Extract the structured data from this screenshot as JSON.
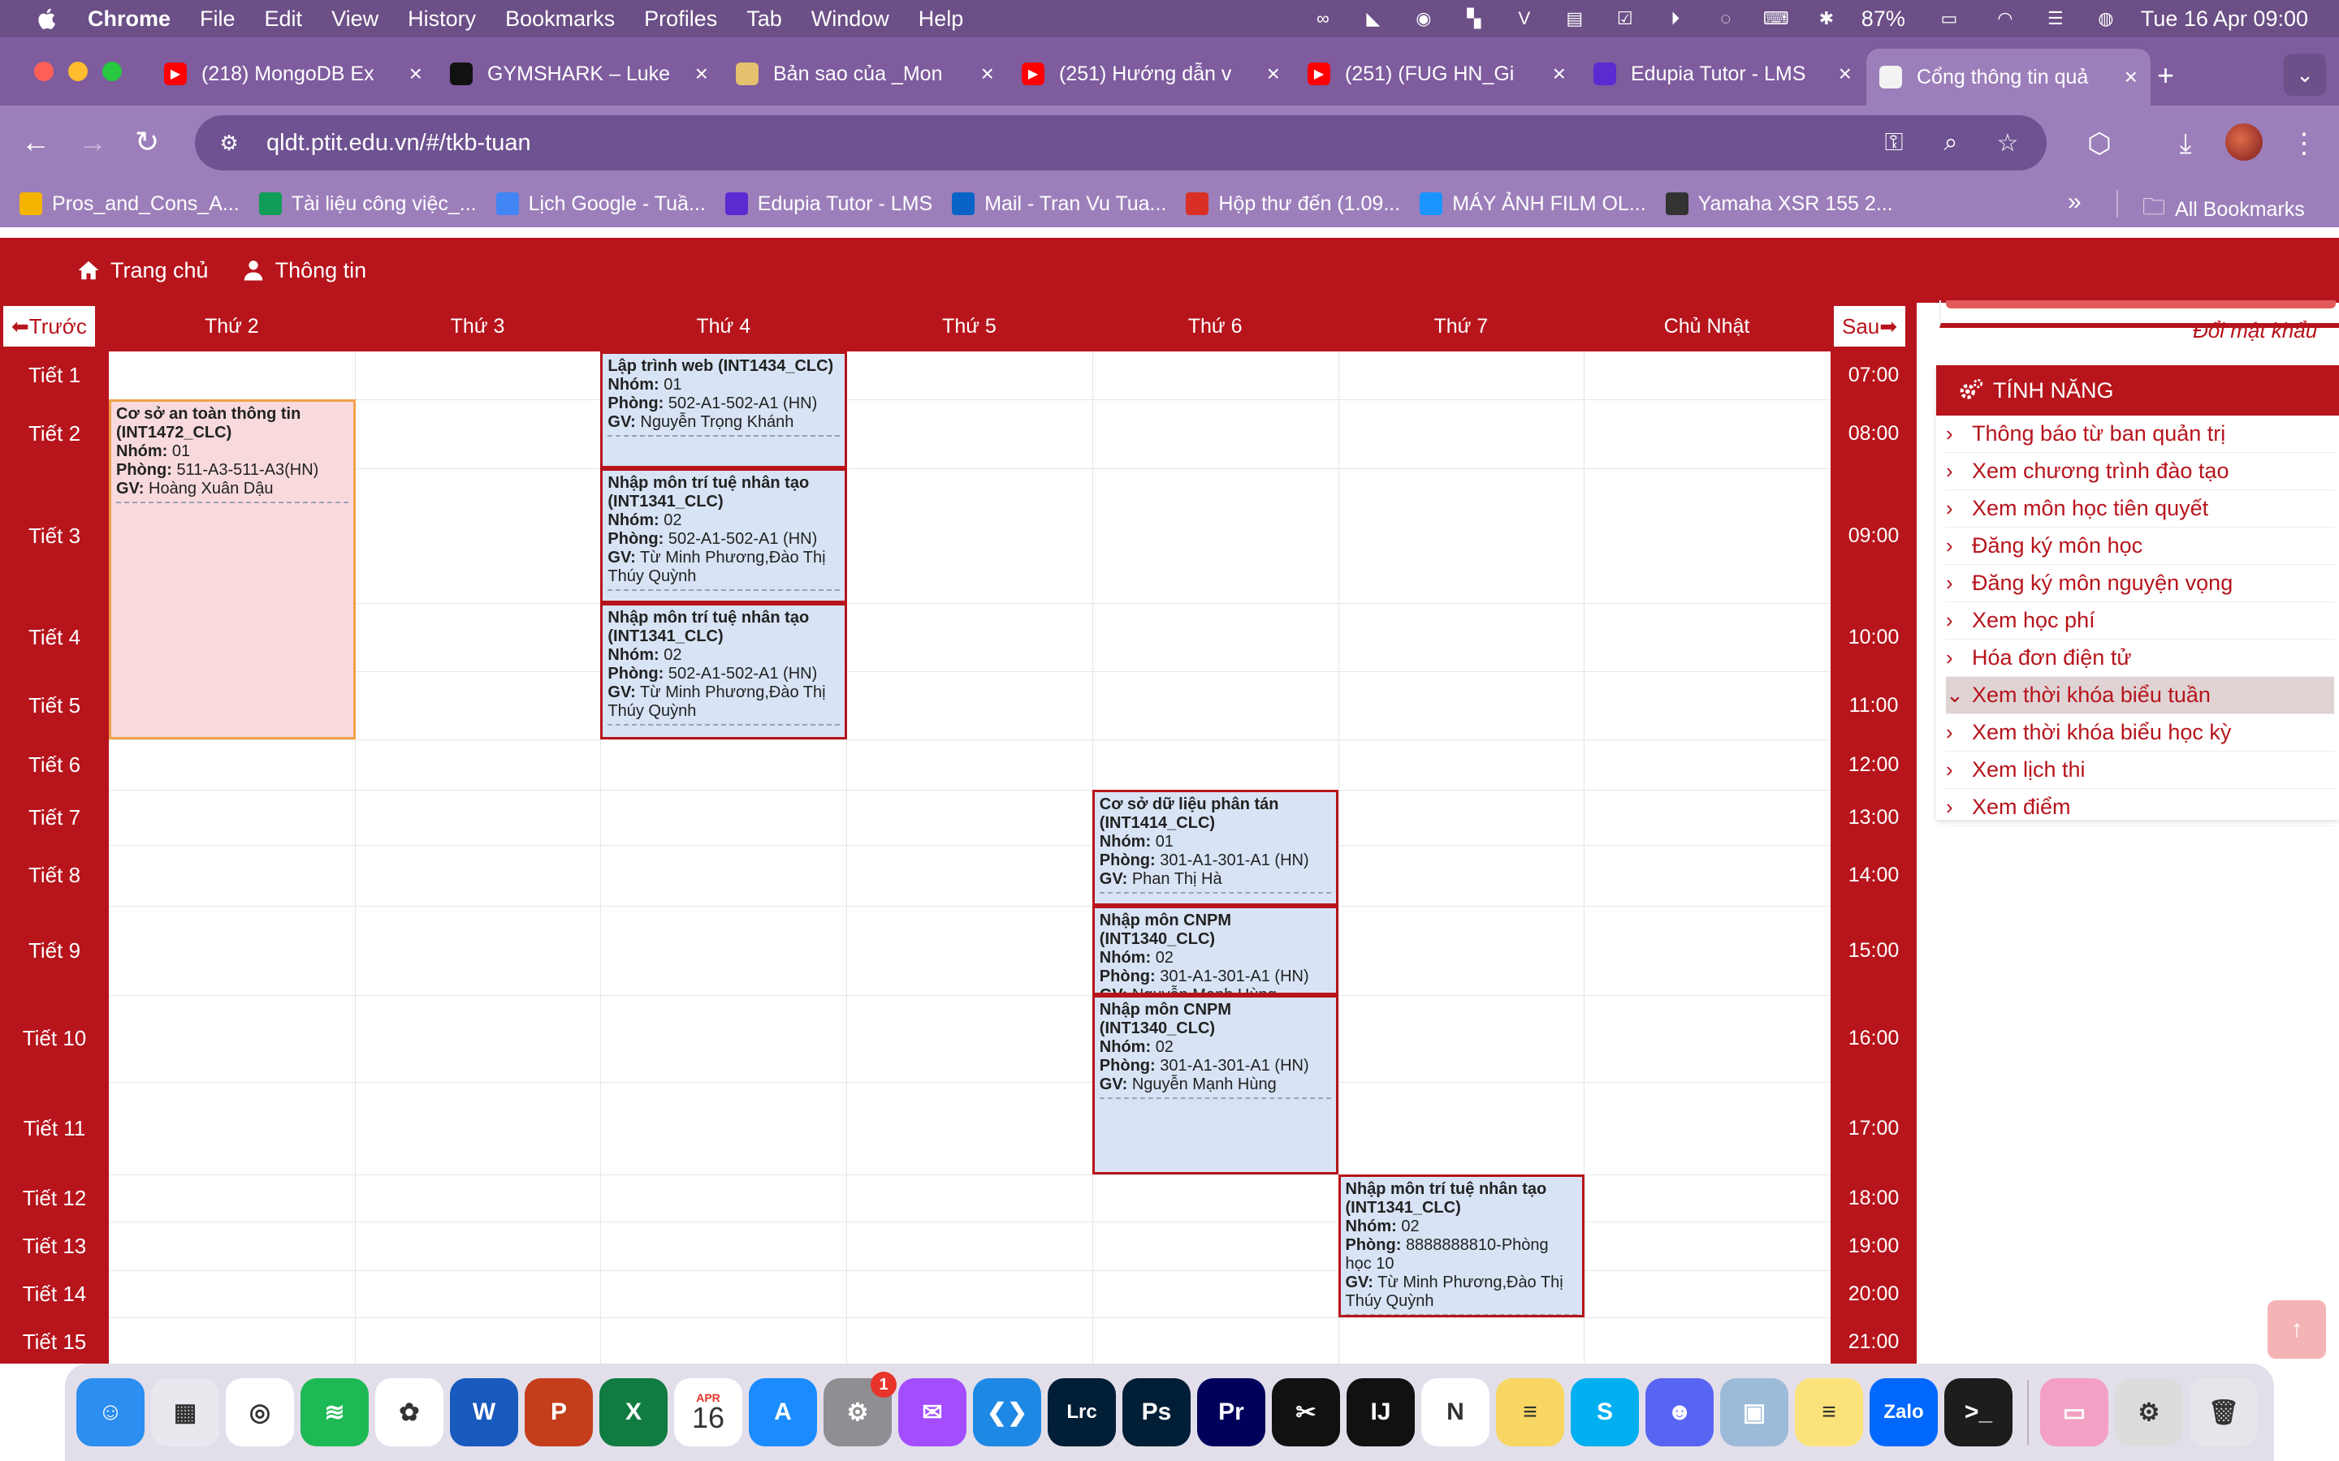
{
  "menubar": {
    "app": "Chrome",
    "items": [
      "File",
      "Edit",
      "View",
      "History",
      "Bookmarks",
      "Profiles",
      "Tab",
      "Window",
      "Help"
    ],
    "battery": "87%",
    "clock": "Tue 16 Apr  09:00"
  },
  "tabs": [
    {
      "title": "(218) MongoDB Ex",
      "icon": "youtube-icon",
      "color": "#ff0000"
    },
    {
      "title": "GYMSHARK – Luke",
      "icon": "gymshark-icon",
      "color": "#111111"
    },
    {
      "title": "Bản sao của _Mon",
      "icon": "doc-icon",
      "color": "#e3c16f"
    },
    {
      "title": "(251) Hướng dẫn v",
      "icon": "youtube-icon",
      "color": "#ff0000"
    },
    {
      "title": "(251) (FUG HN_Gi",
      "icon": "youtube-icon",
      "color": "#ff0000"
    },
    {
      "title": "Edupia Tutor - LMS",
      "icon": "edupia-icon",
      "color": "#5b2bd1"
    },
    {
      "title": "Cổng thông tin quả",
      "icon": "ptit-icon",
      "color": "#f3f3f3",
      "active": true
    }
  ],
  "address": {
    "url": "qldt.ptit.edu.vn/#/tkb-tuan"
  },
  "bookmarks": [
    {
      "label": "Pros_and_Cons_A...",
      "icon": "drive-icon",
      "color": "#f4b400"
    },
    {
      "label": "Tài liệu công việc_...",
      "icon": "sheets-icon",
      "color": "#0f9d58"
    },
    {
      "label": "Lịch Google - Tuầ...",
      "icon": "calendar-icon",
      "color": "#4285f4"
    },
    {
      "label": "Edupia Tutor - LMS",
      "icon": "edupia-icon",
      "color": "#5b2bd1"
    },
    {
      "label": "Mail - Tran Vu Tua...",
      "icon": "outlook-icon",
      "color": "#0a64c8"
    },
    {
      "label": "Hộp thư đến (1.09...",
      "icon": "gmail-icon",
      "color": "#d93025"
    },
    {
      "label": "MÁY ẢNH FILM OL...",
      "icon": "tiki-icon",
      "color": "#1a94ff"
    },
    {
      "label": "Yamaha XSR 155 2...",
      "icon": "yamaha-icon",
      "color": "#333333"
    }
  ],
  "bookmarks_all": "All Bookmarks",
  "sitenav": {
    "home": "Trang chủ",
    "info": "Thông tin"
  },
  "timetable": {
    "prev": "Trước",
    "next": "Sau",
    "days": [
      "Thứ 2",
      "Thứ 3",
      "Thứ 4",
      "Thứ 5",
      "Thứ 6",
      "Thứ 7",
      "Chủ Nhật"
    ],
    "periods": [
      {
        "label": "Tiết 1",
        "time": "07:00"
      },
      {
        "label": "Tiết 2",
        "time": "08:00"
      },
      {
        "label": "Tiết 3",
        "time": "09:00"
      },
      {
        "label": "Tiết 4",
        "time": "10:00"
      },
      {
        "label": "Tiết 5",
        "time": "11:00"
      },
      {
        "label": "Tiết 6",
        "time": "12:00"
      },
      {
        "label": "Tiết 7",
        "time": "13:00"
      },
      {
        "label": "Tiết 8",
        "time": "14:00"
      },
      {
        "label": "Tiết 9",
        "time": "15:00"
      },
      {
        "label": "Tiết 10",
        "time": "16:00"
      },
      {
        "label": "Tiết 11",
        "time": "17:00"
      },
      {
        "label": "Tiết 12",
        "time": "18:00"
      },
      {
        "label": "Tiết 13",
        "time": "19:00"
      },
      {
        "label": "Tiết 14",
        "time": "20:00"
      },
      {
        "label": "Tiết 15",
        "time": "21:00"
      }
    ],
    "events": [
      {
        "day": 0,
        "from": 2,
        "to": 5,
        "style": "pink",
        "name": "Cơ sở an toàn thông tin (INT1472_CLC)",
        "group": "01",
        "room": "511-A3-511-A3(HN)",
        "teacher": "Hoàng Xuân Dậu"
      },
      {
        "day": 2,
        "from": 1,
        "to": 2,
        "style": "blue",
        "name": "Lập trình web (INT1434_CLC)",
        "group": "01",
        "room": "502-A1-502-A1 (HN)",
        "teacher": "Nguyễn Trọng Khánh"
      },
      {
        "day": 2,
        "from": 3,
        "to": 3,
        "style": "blue",
        "name": "Nhập môn trí tuệ nhân tạo (INT1341_CLC)",
        "group": "02",
        "room": "502-A1-502-A1 (HN)",
        "teacher": "Từ Minh Phương,Đào Thị Thúy Quỳnh"
      },
      {
        "day": 2,
        "from": 4,
        "to": 5,
        "style": "blue",
        "name": "Nhập môn trí tuệ nhân tạo (INT1341_CLC)",
        "group": "02",
        "room": "502-A1-502-A1 (HN)",
        "teacher": "Từ Minh Phương,Đào Thị Thúy Quỳnh"
      },
      {
        "day": 4,
        "from": 7,
        "to": 8,
        "style": "blue",
        "name": "Cơ sở dữ liệu phân tán (INT1414_CLC)",
        "group": "01",
        "room": "301-A1-301-A1 (HN)",
        "teacher": "Phan Thị Hà"
      },
      {
        "day": 4,
        "from": 9,
        "to": 9,
        "style": "blue",
        "name": "Nhập môn CNPM (INT1340_CLC)",
        "group": "02",
        "room": "301-A1-301-A1 (HN)",
        "teacher": "Nguyễn Mạnh Hùng"
      },
      {
        "day": 4,
        "from": 10,
        "to": 11,
        "style": "blue",
        "name": "Nhập môn CNPM (INT1340_CLC)",
        "group": "02",
        "room": "301-A1-301-A1 (HN)",
        "teacher": "Nguyễn Mạnh Hùng"
      },
      {
        "day": 5,
        "from": 12,
        "to": 14,
        "style": "blue",
        "name": "Nhập môn trí tuệ nhân tạo (INT1341_CLC)",
        "group": "02",
        "room": "8888888810-Phòng học 10",
        "teacher": "Từ Minh Phương,Đào Thị Thúy Quỳnh"
      }
    ],
    "labels": {
      "group": "Nhóm:",
      "room": "Phòng:",
      "teacher": "GV:"
    }
  },
  "sidebar": {
    "change_password": "Đổi mật khẩu",
    "features_title": "TÍNH NĂNG",
    "items": [
      {
        "label": "Thông báo từ ban quản trị"
      },
      {
        "label": "Xem chương trình đào tạo"
      },
      {
        "label": "Xem môn học tiên quyết"
      },
      {
        "label": "Đăng ký môn học"
      },
      {
        "label": "Đăng ký môn nguyện vọng"
      },
      {
        "label": "Xem học phí"
      },
      {
        "label": "Hóa đơn điện tử"
      },
      {
        "label": "Xem thời khóa biểu tuần",
        "active": true
      },
      {
        "label": "Xem thời khóa biểu học kỳ"
      },
      {
        "label": "Xem lịch thi"
      },
      {
        "label": "Xem điểm"
      }
    ]
  },
  "dock": [
    {
      "name": "finder",
      "color": "#2b8ef0",
      "glyph": "☺"
    },
    {
      "name": "launchpad",
      "color": "#e8e8ee",
      "glyph": "▦"
    },
    {
      "name": "chrome",
      "color": "#ffffff",
      "glyph": "◎"
    },
    {
      "name": "spotify",
      "color": "#1db954",
      "glyph": "≋"
    },
    {
      "name": "photos",
      "color": "#ffffff",
      "glyph": "✿"
    },
    {
      "name": "word",
      "color": "#185abd",
      "glyph": "W"
    },
    {
      "name": "powerpoint",
      "color": "#c43e1c",
      "glyph": "P"
    },
    {
      "name": "excel",
      "color": "#107c41",
      "glyph": "X"
    },
    {
      "name": "calendar",
      "color": "#ffffff",
      "glyph": "16",
      "month": "APR"
    },
    {
      "name": "app-store",
      "color": "#1a8cff",
      "glyph": "A"
    },
    {
      "name": "system-settings",
      "color": "#8e8e93",
      "glyph": "⚙",
      "badge": "1"
    },
    {
      "name": "messenger",
      "color": "#a34dff",
      "glyph": "✉"
    },
    {
      "name": "vscode",
      "color": "#1e88e5",
      "glyph": "❮❯"
    },
    {
      "name": "lightroom",
      "color": "#001e36",
      "glyph": "Lrc"
    },
    {
      "name": "photoshop",
      "color": "#001e36",
      "glyph": "Ps"
    },
    {
      "name": "premiere",
      "color": "#00005b",
      "glyph": "Pr"
    },
    {
      "name": "capcut",
      "color": "#111111",
      "glyph": "✂"
    },
    {
      "name": "intellij",
      "color": "#111111",
      "glyph": "IJ"
    },
    {
      "name": "notion",
      "color": "#ffffff",
      "glyph": "N"
    },
    {
      "name": "stickies",
      "color": "#f7d663",
      "glyph": "≡"
    },
    {
      "name": "skype",
      "color": "#00aff0",
      "glyph": "S"
    },
    {
      "name": "discord",
      "color": "#5865f2",
      "glyph": "☻"
    },
    {
      "name": "preview",
      "color": "#9bbbd8",
      "glyph": "▣"
    },
    {
      "name": "notes",
      "color": "#fbe27a",
      "glyph": "≡"
    },
    {
      "name": "zalo",
      "color": "#0068ff",
      "glyph": "Zalo"
    },
    {
      "name": "terminal",
      "color": "#1d1d1d",
      "glyph": ">_"
    },
    {
      "name": "macbook-folder",
      "color": "#f3a0c4",
      "glyph": "▭"
    },
    {
      "name": "automator",
      "color": "#dcdcdc",
      "glyph": "⚙"
    },
    {
      "name": "trash",
      "color": "#e6e6ea",
      "glyph": "🗑"
    }
  ]
}
